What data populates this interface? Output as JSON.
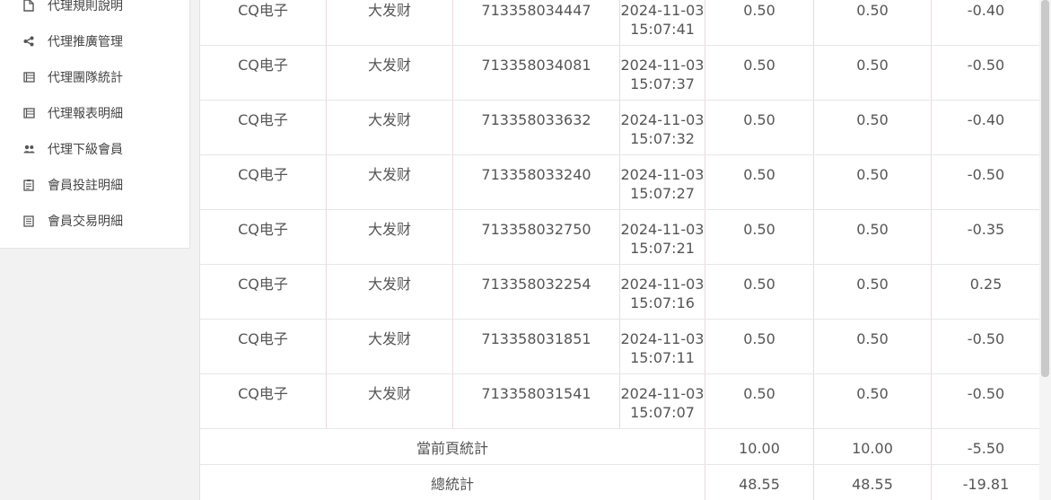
{
  "sidebar": {
    "items": [
      {
        "label": "代理規則說明",
        "icon": "document-icon"
      },
      {
        "label": "代理推廣管理",
        "icon": "share-icon"
      },
      {
        "label": "代理團隊統計",
        "icon": "list-icon"
      },
      {
        "label": "代理報表明細",
        "icon": "list-icon"
      },
      {
        "label": "代理下級會員",
        "icon": "users-icon"
      },
      {
        "label": "會員投註明細",
        "icon": "clipboard-icon"
      },
      {
        "label": "會員交易明細",
        "icon": "receipt-icon"
      }
    ]
  },
  "table": {
    "rows": [
      {
        "game": "CQ电子",
        "name": "大发财",
        "order": "713358034447",
        "date": "2024-11-03",
        "time": "15:07:41",
        "bet": "0.50",
        "valid": "0.50",
        "result": "-0.40"
      },
      {
        "game": "CQ电子",
        "name": "大发财",
        "order": "713358034081",
        "date": "2024-11-03",
        "time": "15:07:37",
        "bet": "0.50",
        "valid": "0.50",
        "result": "-0.50"
      },
      {
        "game": "CQ电子",
        "name": "大发财",
        "order": "713358033632",
        "date": "2024-11-03",
        "time": "15:07:32",
        "bet": "0.50",
        "valid": "0.50",
        "result": "-0.40"
      },
      {
        "game": "CQ电子",
        "name": "大发财",
        "order": "713358033240",
        "date": "2024-11-03",
        "time": "15:07:27",
        "bet": "0.50",
        "valid": "0.50",
        "result": "-0.50"
      },
      {
        "game": "CQ电子",
        "name": "大发财",
        "order": "713358032750",
        "date": "2024-11-03",
        "time": "15:07:21",
        "bet": "0.50",
        "valid": "0.50",
        "result": "-0.35"
      },
      {
        "game": "CQ电子",
        "name": "大发财",
        "order": "713358032254",
        "date": "2024-11-03",
        "time": "15:07:16",
        "bet": "0.50",
        "valid": "0.50",
        "result": "0.25"
      },
      {
        "game": "CQ电子",
        "name": "大发财",
        "order": "713358031851",
        "date": "2024-11-03",
        "time": "15:07:11",
        "bet": "0.50",
        "valid": "0.50",
        "result": "-0.50"
      },
      {
        "game": "CQ电子",
        "name": "大发财",
        "order": "713358031541",
        "date": "2024-11-03",
        "time": "15:07:07",
        "bet": "0.50",
        "valid": "0.50",
        "result": "-0.50"
      }
    ],
    "page_total": {
      "label": "當前頁統計",
      "bet": "10.00",
      "valid": "10.00",
      "result": "-5.50"
    },
    "grand_total": {
      "label": "總統計",
      "bet": "48.55",
      "valid": "48.55",
      "result": "-19.81"
    }
  }
}
